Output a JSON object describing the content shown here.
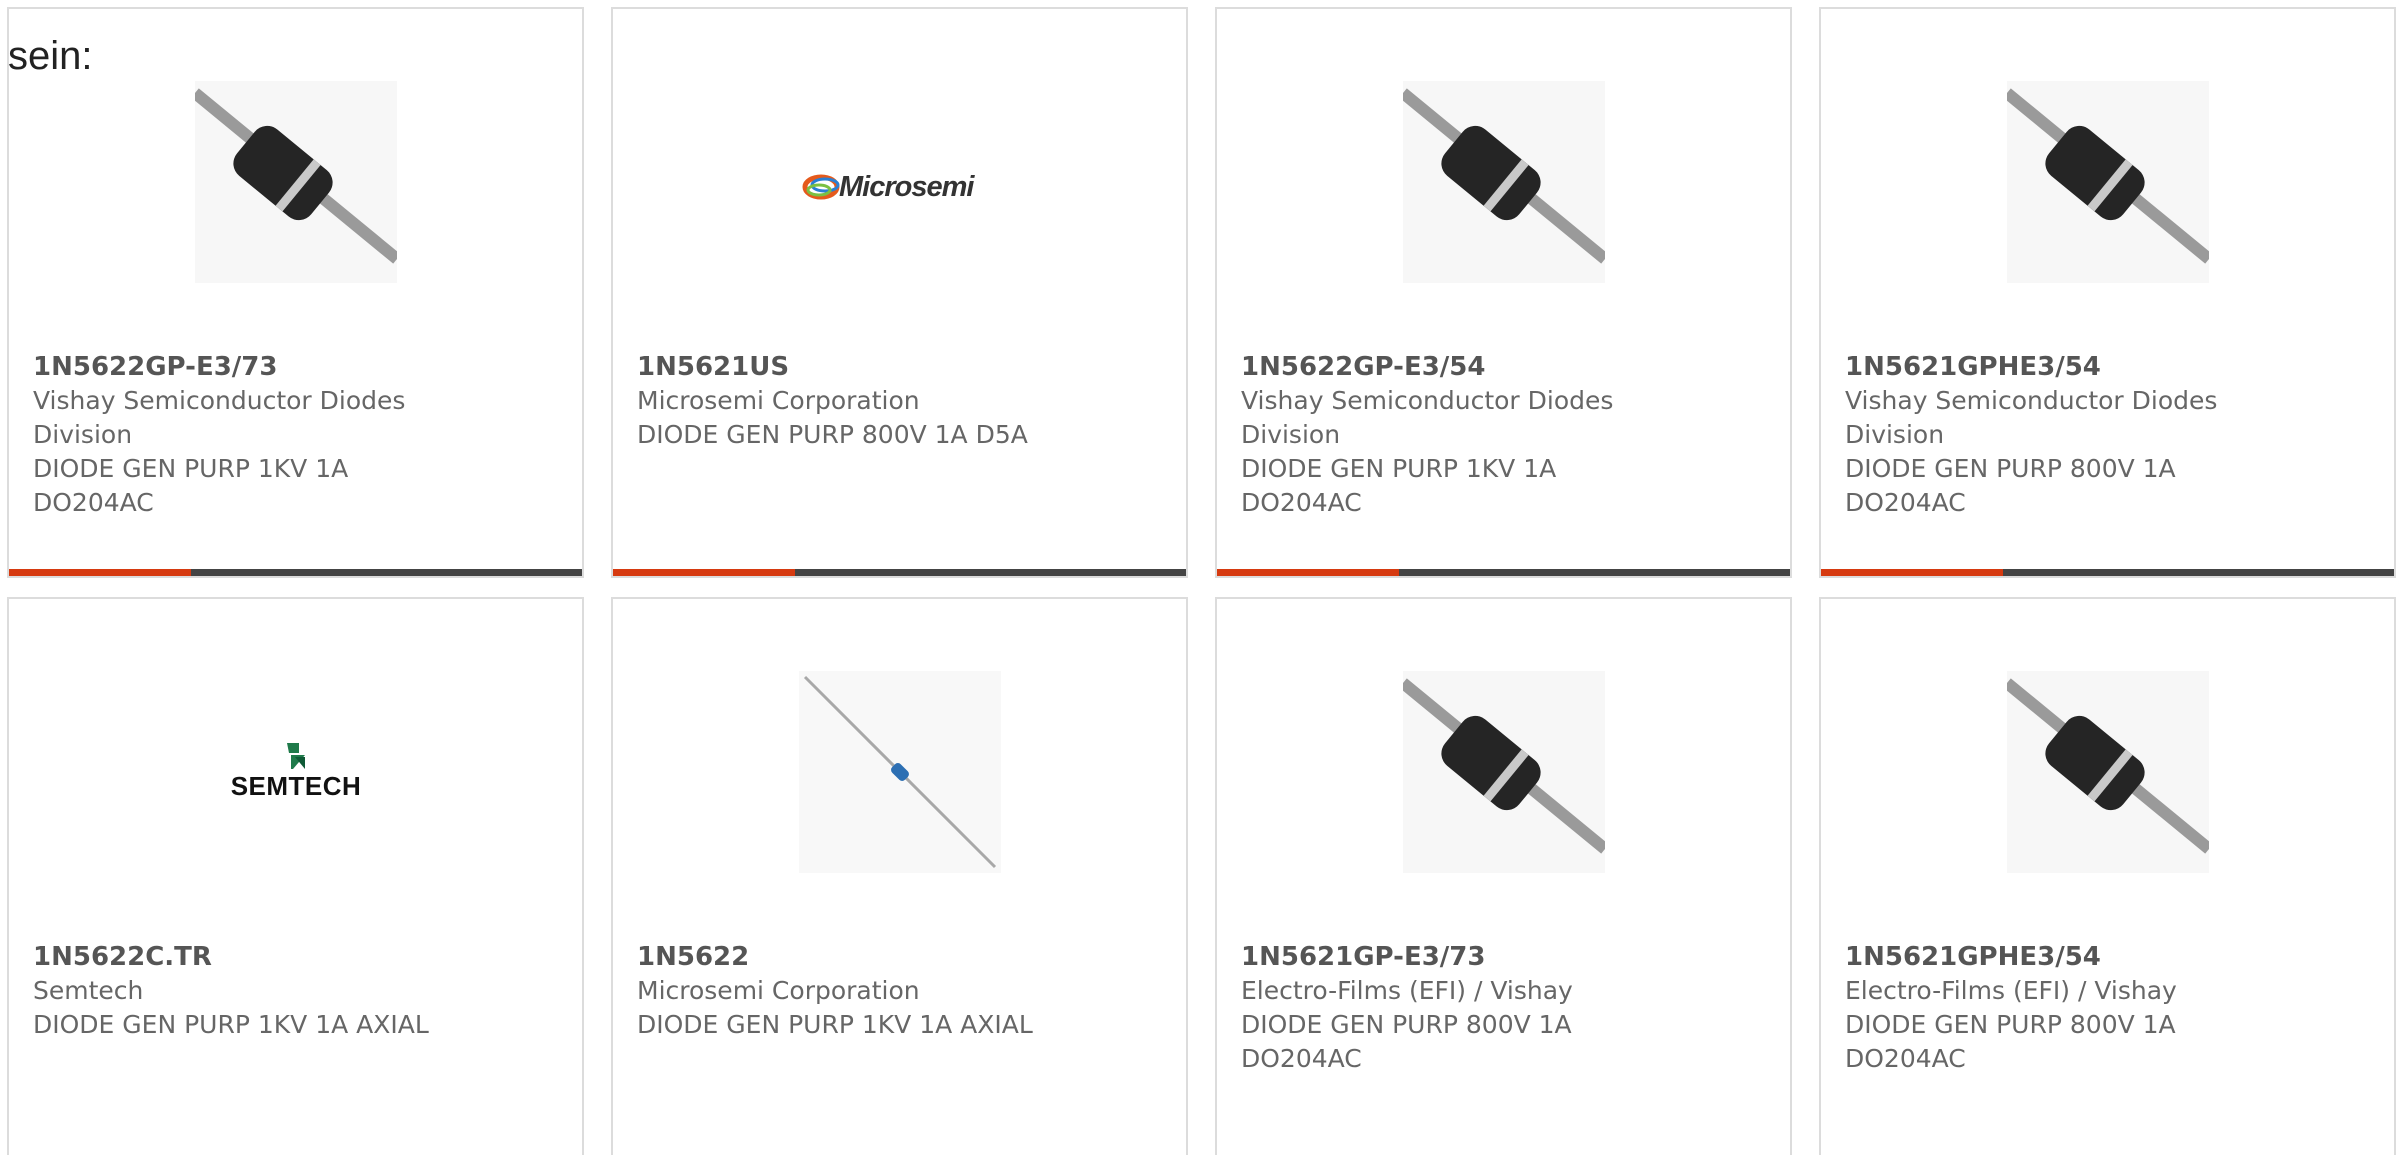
{
  "intro_text": "sein:",
  "colors": {
    "accent": "#d63a10",
    "bar": "#444444",
    "border": "#dcdcdc"
  },
  "products": [
    {
      "part": "1N5622GP-E3/73",
      "manufacturer": "Vishay Semiconductor Diodes Division",
      "description": "DIODE GEN PURP 1KV 1A DO204AC",
      "image_type": "diode-image"
    },
    {
      "part": "1N5621US",
      "manufacturer": "Microsemi Corporation",
      "description": "DIODE GEN PURP 800V 1A D5A",
      "image_type": "microsemi-logo",
      "logo_text": "Microsemi"
    },
    {
      "part": "1N5622GP-E3/54",
      "manufacturer": "Vishay Semiconductor Diodes Division",
      "description": "DIODE GEN PURP 1KV 1A DO204AC",
      "image_type": "diode-image"
    },
    {
      "part": "1N5621GPHE3/54",
      "manufacturer": "Vishay Semiconductor Diodes Division",
      "description": "DIODE GEN PURP 800V 1A DO204AC",
      "image_type": "diode-image"
    },
    {
      "part": "1N5622C.TR",
      "manufacturer": "Semtech",
      "description": "DIODE GEN PURP 1KV 1A AXIAL",
      "image_type": "semtech-logo",
      "logo_text": "SEMTECH"
    },
    {
      "part": "1N5622",
      "manufacturer": "Microsemi Corporation",
      "description": "DIODE GEN PURP 1KV 1A AXIAL",
      "image_type": "axial-diode-image"
    },
    {
      "part": "1N5621GP-E3/73",
      "manufacturer": "Electro-Films (EFI) / Vishay",
      "description": "DIODE GEN PURP 800V 1A DO204AC",
      "image_type": "diode-image"
    },
    {
      "part": "1N5621GPHE3/54",
      "manufacturer": "Electro-Films (EFI) / Vishay",
      "description": "DIODE GEN PURP 800V 1A DO204AC",
      "image_type": "diode-image"
    }
  ]
}
